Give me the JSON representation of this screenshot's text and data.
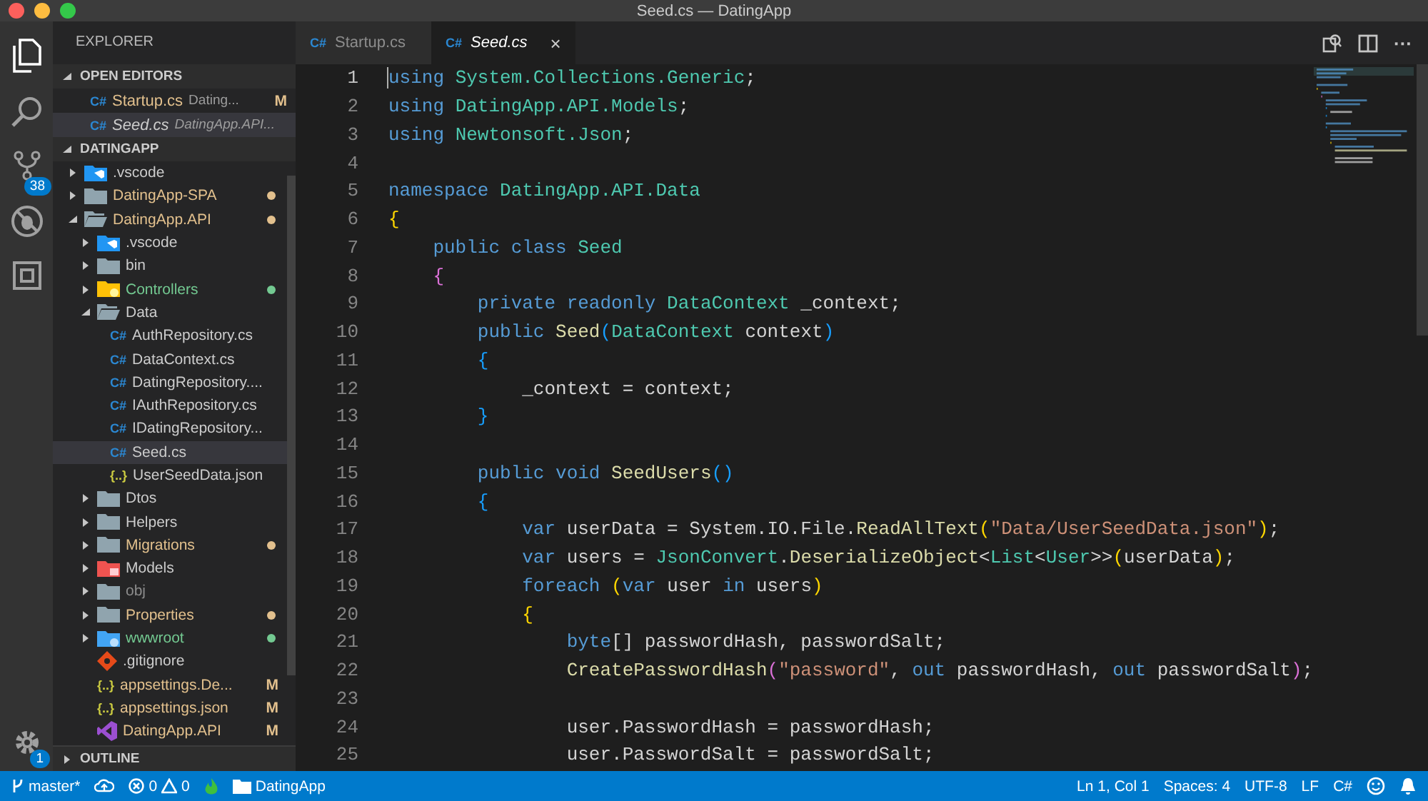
{
  "window": {
    "title": "Seed.cs — DatingApp"
  },
  "activity_bar": {
    "source_control_badge": "38",
    "settings_badge": "1"
  },
  "sidebar": {
    "title": "EXPLORER",
    "open_editors": {
      "title": "OPEN EDITORS",
      "expanded": true,
      "items": [
        {
          "glyph": "C#",
          "name": "Startup.cs",
          "path": "Dating...",
          "badge": "M",
          "color": "#e2c08d",
          "preview": false,
          "selected": false
        },
        {
          "glyph": "C#",
          "name": "Seed.cs",
          "path": "DatingApp.API...",
          "color": "#cccccc",
          "preview": true,
          "selected": true
        }
      ]
    },
    "workspace": {
      "title": "DATINGAPP",
      "expanded": true,
      "items": [
        {
          "kind": "vscode_folder",
          "name": ".vscode",
          "expanded": false,
          "color": "#cccccc",
          "dot": false,
          "selected": false
        },
        {
          "kind": "folder",
          "name": "DatingApp-SPA",
          "expanded": false,
          "color": "#e2c08d",
          "dot": true,
          "selected": false
        },
        {
          "kind": "folder",
          "name": "DatingApp.API",
          "expanded": true,
          "color": "#e2c08d",
          "dot": true,
          "selected": false,
          "children": [
            {
              "kind": "vscode_folder",
              "name": ".vscode",
              "expanded": false,
              "color": "#cccccc",
              "dot": false,
              "selected": false
            },
            {
              "kind": "folder",
              "name": "bin",
              "expanded": false,
              "color": "#cccccc",
              "dot": false,
              "selected": false
            },
            {
              "kind": "controllers_folder",
              "name": "Controllers",
              "expanded": false,
              "color": "#73c991",
              "dot": true,
              "selected": false
            },
            {
              "kind": "folder",
              "name": "Data",
              "expanded": true,
              "color": "#cccccc",
              "dot": false,
              "selected": false,
              "children": [
                {
                  "kind": "csharp",
                  "glyph": "C#",
                  "name": "AuthRepository.cs",
                  "color": "#cccccc",
                  "selected": false
                },
                {
                  "kind": "csharp",
                  "glyph": "C#",
                  "name": "DataContext.cs",
                  "color": "#cccccc",
                  "selected": false
                },
                {
                  "kind": "csharp",
                  "glyph": "C#",
                  "name": "DatingRepository....",
                  "color": "#cccccc",
                  "selected": false
                },
                {
                  "kind": "csharp",
                  "glyph": "C#",
                  "name": "IAuthRepository.cs",
                  "color": "#cccccc",
                  "selected": false
                },
                {
                  "kind": "csharp",
                  "glyph": "C#",
                  "name": "IDatingRepository...",
                  "color": "#cccccc",
                  "selected": false
                },
                {
                  "kind": "csharp",
                  "glyph": "C#",
                  "name": "Seed.cs",
                  "color": "#cccccc",
                  "selected": true
                },
                {
                  "kind": "json",
                  "glyph": "{..}",
                  "name": "UserSeedData.json",
                  "color": "#cccccc",
                  "selected": false
                }
              ]
            },
            {
              "kind": "folder",
              "name": "Dtos",
              "expanded": false,
              "color": "#cccccc",
              "dot": false,
              "selected": false
            },
            {
              "kind": "folder",
              "name": "Helpers",
              "expanded": false,
              "color": "#cccccc",
              "dot": false,
              "selected": false
            },
            {
              "kind": "folder",
              "name": "Migrations",
              "expanded": false,
              "color": "#e2c08d",
              "dot": true,
              "selected": false
            },
            {
              "kind": "models_folder",
              "name": "Models",
              "expanded": false,
              "color": "#cccccc",
              "dot": false,
              "selected": false
            },
            {
              "kind": "folder",
              "name": "obj",
              "expanded": false,
              "color": "#8c8c8c",
              "dot": false,
              "selected": false
            },
            {
              "kind": "folder",
              "name": "Properties",
              "expanded": false,
              "color": "#e2c08d",
              "dot": true,
              "selected": false
            },
            {
              "kind": "www_folder",
              "name": "wwwroot",
              "expanded": false,
              "color": "#73c991",
              "dot": true,
              "selected": false
            },
            {
              "kind": "git",
              "name": ".gitignore",
              "color": "#cccccc",
              "selected": false
            },
            {
              "kind": "json",
              "glyph": "{..}",
              "name": "appsettings.De...",
              "badge": "M",
              "color": "#e2c08d",
              "selected": false
            },
            {
              "kind": "json",
              "glyph": "{..}",
              "name": "appsettings.json",
              "badge": "M",
              "color": "#e2c08d",
              "selected": false
            },
            {
              "kind": "vs",
              "name": "DatingApp.API",
              "badge": "M",
              "color": "#e2c08d",
              "selected": false
            }
          ]
        }
      ]
    },
    "outline": {
      "title": "OUTLINE",
      "expanded": false
    }
  },
  "tabs": [
    {
      "glyph": "C#",
      "label": "Startup.cs",
      "selected": false,
      "preview": false
    },
    {
      "glyph": "C#",
      "label": "Seed.cs",
      "selected": true,
      "preview": true,
      "close": "×"
    }
  ],
  "editor_actions": {
    "more": "···"
  },
  "code": [
    {
      "number": "1",
      "current": true,
      "tokens": [
        {
          "kind": "kw",
          "text": "using "
        },
        {
          "kind": "type",
          "text": "System.Collections.Generic"
        },
        {
          "kind": "plain",
          "text": ";"
        }
      ]
    },
    {
      "number": "2",
      "current": false,
      "tokens": [
        {
          "kind": "kw",
          "text": "using "
        },
        {
          "kind": "type",
          "text": "DatingApp.API.Models"
        },
        {
          "kind": "plain",
          "text": ";"
        }
      ]
    },
    {
      "number": "3",
      "current": false,
      "tokens": [
        {
          "kind": "kw",
          "text": "using "
        },
        {
          "kind": "type",
          "text": "Newtonsoft.Json"
        },
        {
          "kind": "plain",
          "text": ";"
        }
      ]
    },
    {
      "number": "4",
      "current": false
    },
    {
      "number": "5",
      "current": false,
      "tokens": [
        {
          "kind": "kw",
          "text": "namespace "
        },
        {
          "kind": "type",
          "text": "DatingApp.API.Data"
        }
      ]
    },
    {
      "number": "6",
      "current": false,
      "tokens": [
        {
          "kind": "brace1",
          "text": "{"
        }
      ]
    },
    {
      "number": "7",
      "current": false,
      "tokens": [
        {
          "kind": "kw",
          "text": "    public class "
        },
        {
          "kind": "type",
          "text": "Seed"
        }
      ]
    },
    {
      "number": "8",
      "current": false,
      "tokens": [
        {
          "kind": "brace2",
          "text": "    {"
        }
      ]
    },
    {
      "number": "9",
      "current": false,
      "tokens": [
        {
          "kind": "kw",
          "text": "        private readonly "
        },
        {
          "kind": "type",
          "text": "DataContext"
        },
        {
          "kind": "plain",
          "text": " _context;"
        }
      ]
    },
    {
      "number": "10",
      "current": false,
      "tokens": [
        {
          "kind": "kw",
          "text": "        public "
        },
        {
          "kind": "fn",
          "text": "Seed"
        },
        {
          "kind": "brace3",
          "text": "("
        },
        {
          "kind": "type",
          "text": "DataContext"
        },
        {
          "kind": "plain",
          "text": " context"
        },
        {
          "kind": "brace3",
          "text": ")"
        }
      ]
    },
    {
      "number": "11",
      "current": false,
      "tokens": [
        {
          "kind": "brace3",
          "text": "        {"
        }
      ]
    },
    {
      "number": "12",
      "current": false,
      "tokens": [
        {
          "kind": "plain",
          "text": "            _context = context;"
        }
      ]
    },
    {
      "number": "13",
      "current": false,
      "tokens": [
        {
          "kind": "brace3",
          "text": "        }"
        }
      ]
    },
    {
      "number": "14",
      "current": false
    },
    {
      "number": "15",
      "current": false,
      "tokens": [
        {
          "kind": "kw",
          "text": "        public void "
        },
        {
          "kind": "fn",
          "text": "SeedUsers"
        },
        {
          "kind": "brace3",
          "text": "()"
        }
      ]
    },
    {
      "number": "16",
      "current": false,
      "tokens": [
        {
          "kind": "brace3",
          "text": "        {"
        }
      ]
    },
    {
      "number": "17",
      "current": false,
      "tokens": [
        {
          "kind": "kw",
          "text": "            var "
        },
        {
          "kind": "plain",
          "text": "userData = System.IO.File."
        },
        {
          "kind": "fn",
          "text": "ReadAllText"
        },
        {
          "kind": "brace1",
          "text": "("
        },
        {
          "kind": "str",
          "text": "\"Data/UserSeedData.json\""
        },
        {
          "kind": "brace1",
          "text": ")"
        },
        {
          "kind": "plain",
          "text": ";"
        }
      ]
    },
    {
      "number": "18",
      "current": false,
      "tokens": [
        {
          "kind": "kw",
          "text": "            var "
        },
        {
          "kind": "plain",
          "text": "users = "
        },
        {
          "kind": "type",
          "text": "JsonConvert"
        },
        {
          "kind": "plain",
          "text": "."
        },
        {
          "kind": "fn",
          "text": "DeserializeObject"
        },
        {
          "kind": "plain",
          "text": "<"
        },
        {
          "kind": "type",
          "text": "List"
        },
        {
          "kind": "plain",
          "text": "<"
        },
        {
          "kind": "type",
          "text": "User"
        },
        {
          "kind": "plain",
          "text": ">>"
        },
        {
          "kind": "brace1",
          "text": "("
        },
        {
          "kind": "plain",
          "text": "userData"
        },
        {
          "kind": "brace1",
          "text": ")"
        },
        {
          "kind": "plain",
          "text": ";"
        }
      ]
    },
    {
      "number": "19",
      "current": false,
      "tokens": [
        {
          "kind": "kw",
          "text": "            foreach "
        },
        {
          "kind": "brace1",
          "text": "("
        },
        {
          "kind": "kw",
          "text": "var "
        },
        {
          "kind": "plain",
          "text": "user "
        },
        {
          "kind": "kw",
          "text": "in "
        },
        {
          "kind": "plain",
          "text": "users"
        },
        {
          "kind": "brace1",
          "text": ")"
        }
      ]
    },
    {
      "number": "20",
      "current": false,
      "tokens": [
        {
          "kind": "brace1",
          "text": "            {"
        }
      ]
    },
    {
      "number": "21",
      "current": false,
      "tokens": [
        {
          "kind": "kw",
          "text": "                byte"
        },
        {
          "kind": "plain",
          "text": "[] passwordHash, passwordSalt;"
        }
      ]
    },
    {
      "number": "22",
      "current": false,
      "tokens": [
        {
          "kind": "fn",
          "text": "                CreatePasswordHash"
        },
        {
          "kind": "brace2",
          "text": "("
        },
        {
          "kind": "str",
          "text": "\"password\""
        },
        {
          "kind": "plain",
          "text": ", "
        },
        {
          "kind": "kw",
          "text": "out "
        },
        {
          "kind": "plain",
          "text": "passwordHash, "
        },
        {
          "kind": "kw",
          "text": "out "
        },
        {
          "kind": "plain",
          "text": "passwordSalt"
        },
        {
          "kind": "brace2",
          "text": ")"
        },
        {
          "kind": "plain",
          "text": ";"
        }
      ]
    },
    {
      "number": "23",
      "current": false
    },
    {
      "number": "24",
      "current": false,
      "tokens": [
        {
          "kind": "plain",
          "text": "                user.PasswordHash = passwordHash;"
        }
      ]
    },
    {
      "number": "25",
      "current": false,
      "tokens": [
        {
          "kind": "plain",
          "text": "                user.PasswordSalt = passwordSalt;"
        }
      ]
    }
  ],
  "status_bar": {
    "branch": "master*",
    "errors": "0",
    "warnings": "0",
    "folder": "DatingApp",
    "right": [
      "Ln 1, Col 1",
      "Spaces: 4",
      "UTF-8",
      "LF",
      "C#"
    ]
  }
}
